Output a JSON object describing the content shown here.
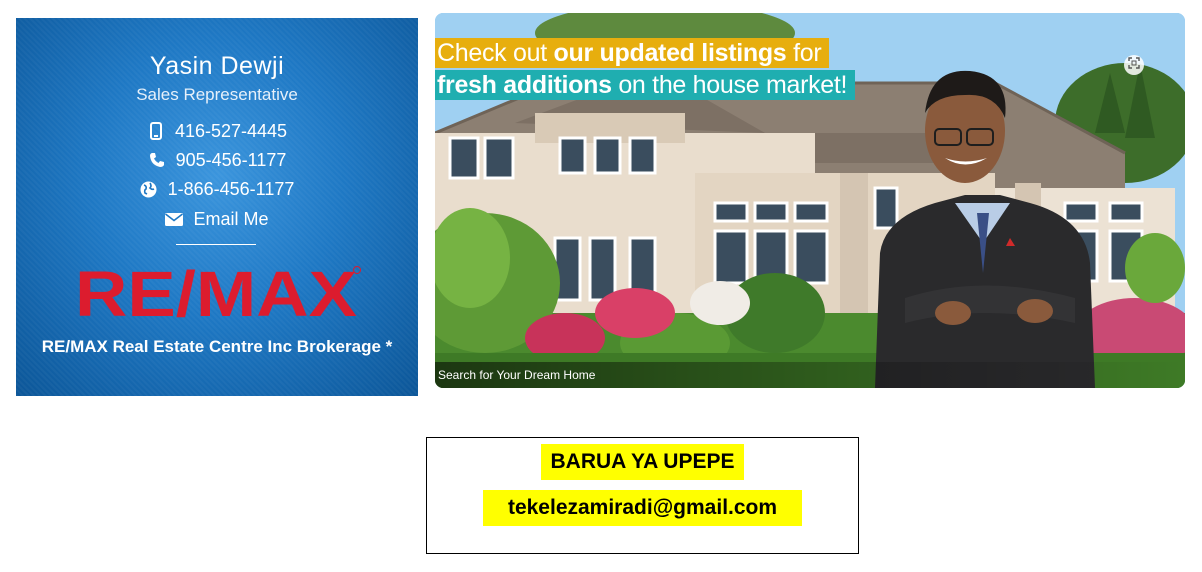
{
  "agent_card": {
    "name": "Yasin Dewji",
    "title": "Sales Representative",
    "contacts": [
      {
        "icon": "mobile-phone-icon",
        "label": "416-527-4445"
      },
      {
        "icon": "phone-icon",
        "label": "905-456-1177"
      },
      {
        "icon": "globe-icon",
        "label": "1-866-456-1177"
      },
      {
        "icon": "envelope-icon",
        "label": "Email Me"
      }
    ],
    "logo_text": "RE/MAX",
    "brokerage": "RE/MAX Real Estate Centre Inc Brokerage *",
    "colors": {
      "card_blue": "#1e78c4",
      "logo_red": "#dc1c2e",
      "logo_blue": "#003da5"
    }
  },
  "banner": {
    "headline_line1_pre": "Check out ",
    "headline_line1_bold": "our updated listings",
    "headline_line1_post": " for",
    "headline_line2_bold": "fresh additions",
    "headline_line2_post": " on the house market!",
    "caption": "Search for Your Dream Home",
    "expand_icon": "expand-icon",
    "colors": {
      "line1_bg": "#e7ae0e",
      "line2_bg": "#1faeb0"
    }
  },
  "email_box": {
    "title": "BARUA YA UPEPE",
    "address": "tekelezamiradi@gmail.com",
    "highlight": "#ffff00"
  }
}
